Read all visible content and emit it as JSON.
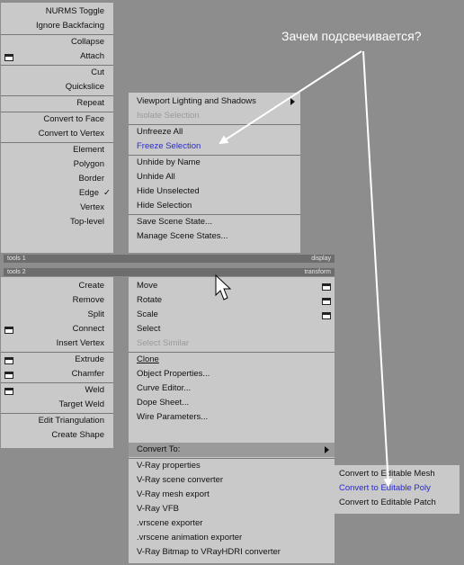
{
  "annotation": "Зачем подсвечивается?",
  "bars": {
    "tools1_left": "tools 1",
    "tools1_right": "display",
    "tools2_left": "tools 2",
    "tools2_right": "transform"
  },
  "left_menu": {
    "items": [
      "NURMS Toggle",
      "Ignore Backfacing",
      "Collapse",
      "Attach",
      "Cut",
      "Quickslice",
      "Repeat",
      "Convert to Face",
      "Convert to Vertex",
      "Element",
      "Polygon",
      "Border",
      "Edge",
      "Vertex",
      "Top-level"
    ],
    "edge_check": "✓"
  },
  "left_menu2": {
    "items": [
      "Create",
      "Remove",
      "Split",
      "Connect",
      "Insert Vertex",
      "Extrude",
      "Chamfer",
      "Weld",
      "Target Weld",
      "Edit Triangulation",
      "Create Shape"
    ]
  },
  "right_top": {
    "items": [
      "Viewport Lighting and Shadows",
      "Isolate Selection",
      "Unfreeze All",
      "Freeze Selection",
      "Unhide by Name",
      "Unhide All",
      "Hide Unselected",
      "Hide Selection",
      "Save Scene State...",
      "Manage Scene States..."
    ]
  },
  "right_bottom": {
    "items": [
      "Move",
      "Rotate",
      "Scale",
      "Select",
      "Select Similar",
      "Clone",
      "Object Properties...",
      "Curve Editor...",
      "Dope Sheet...",
      "Wire Parameters...",
      "Convert To:",
      "V-Ray properties",
      "V-Ray scene converter",
      "V-Ray mesh export",
      "V-Ray VFB",
      ".vrscene exporter",
      ".vrscene animation exporter",
      "V-Ray Bitmap to VRayHDRI converter"
    ]
  },
  "submenu": {
    "items": [
      "Convert to Editable Mesh",
      "Convert to Editable Poly",
      "Convert to Editable Patch"
    ]
  }
}
